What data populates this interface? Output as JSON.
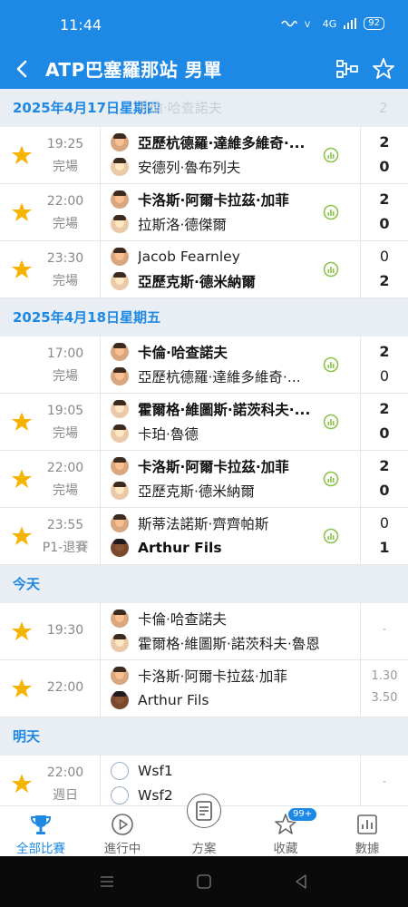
{
  "status": {
    "time": "11:44",
    "battery": "92",
    "network": "4G"
  },
  "header": {
    "title": "ATP巴塞羅那站 男單"
  },
  "sections": [
    {
      "date": "2025年4月17日星期四",
      "ghost_name": "卡倫·哈查諾夫",
      "ghost_score": "2",
      "matches": [
        {
          "time": "19:25",
          "status": "完場",
          "p1": "亞歷杭德羅·達維多維奇·...",
          "p2": "安德列·魯布列夫",
          "s1": "2",
          "s2": "0",
          "p1_bold": true
        },
        {
          "time": "22:00",
          "status": "完場",
          "p1": "卡洛斯·阿爾卡拉茲·加菲",
          "p2": "拉斯洛·德傑爾",
          "s1": "2",
          "s2": "0",
          "p1_bold": true
        },
        {
          "time": "23:30",
          "status": "完場",
          "p1": "Jacob Fearnley",
          "p2": "亞歷克斯·德米納爾",
          "s1": "0",
          "s2": "2",
          "p2_bold": true
        }
      ]
    },
    {
      "date": "2025年4月18日星期五",
      "matches": [
        {
          "time": "17:00",
          "status": "完場",
          "p1": "卡倫·哈查諾夫",
          "p2": "亞歷杭德羅·達維多維奇·...",
          "s1": "2",
          "s2": "0",
          "p1_bold": true
        },
        {
          "time": "19:05",
          "status": "完場",
          "p1": "霍爾格·維圖斯·諾茨科夫·...",
          "p2": "卡珀·魯德",
          "s1": "2",
          "s2": "0",
          "p1_bold": true
        },
        {
          "time": "22:00",
          "status": "完場",
          "p1": "卡洛斯·阿爾卡拉茲·加菲",
          "p2": "亞歷克斯·德米納爾",
          "s1": "2",
          "s2": "0",
          "p1_bold": true
        },
        {
          "time": "23:55",
          "status": "P1-退賽",
          "p1": "斯蒂法諾斯·齊齊帕斯",
          "p2": "Arthur Fils",
          "s1": "0",
          "s2": "1",
          "p2_bold": true
        }
      ]
    },
    {
      "date": "今天",
      "matches": [
        {
          "time": "19:30",
          "p1": "卡倫·哈查諾夫",
          "p2": "霍爾格·維圖斯·諾茨科夫·魯恩",
          "dash": "-"
        },
        {
          "time": "22:00",
          "p1": "卡洛斯·阿爾卡拉茲·加菲",
          "p2": "Arthur Fils",
          "odds1": "1.30",
          "odds2": "3.50"
        }
      ]
    },
    {
      "date": "明天",
      "matches": [
        {
          "time": "22:00",
          "status": "週日",
          "p1": "Wsf1",
          "p2": "Wsf2",
          "dash": "-"
        }
      ]
    }
  ],
  "nav": {
    "items": [
      "全部比賽",
      "進行中",
      "方案",
      "收藏",
      "數據"
    ],
    "badge": "99+"
  },
  "colors": {
    "accent": "#1e88e5",
    "star": "#f5b400",
    "stats": "#8bc34a"
  }
}
